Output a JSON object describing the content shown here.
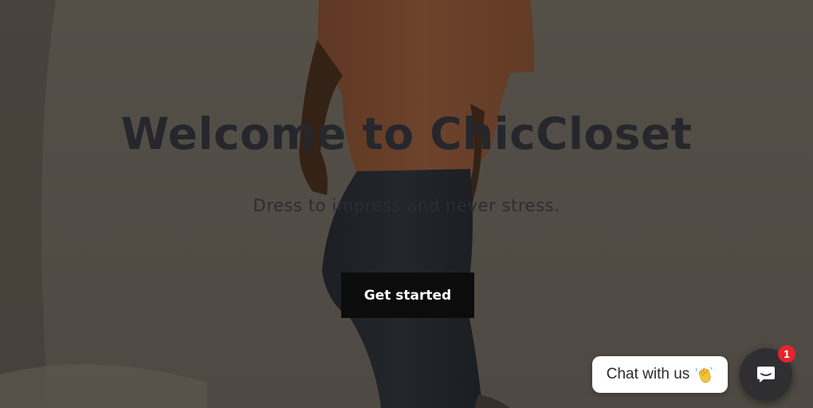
{
  "hero": {
    "title": "Welcome to ChicCloset",
    "subtitle": "Dress to impress and never stress.",
    "cta_label": "Get started",
    "background_image": "man-in-orange-shirt-photo"
  },
  "chat_widget": {
    "bubble_text": "Chat with us",
    "bubble_icon": "waving-hand-icon",
    "launcher_icon": "chat-bubble-icon",
    "badge_count": "1",
    "colors": {
      "launcher": "#2f2f31",
      "badge": "#e5242b"
    }
  },
  "colors": {
    "title": "#25272c",
    "cta_background": "#0c0c0c",
    "cta_text": "#ffffff"
  }
}
